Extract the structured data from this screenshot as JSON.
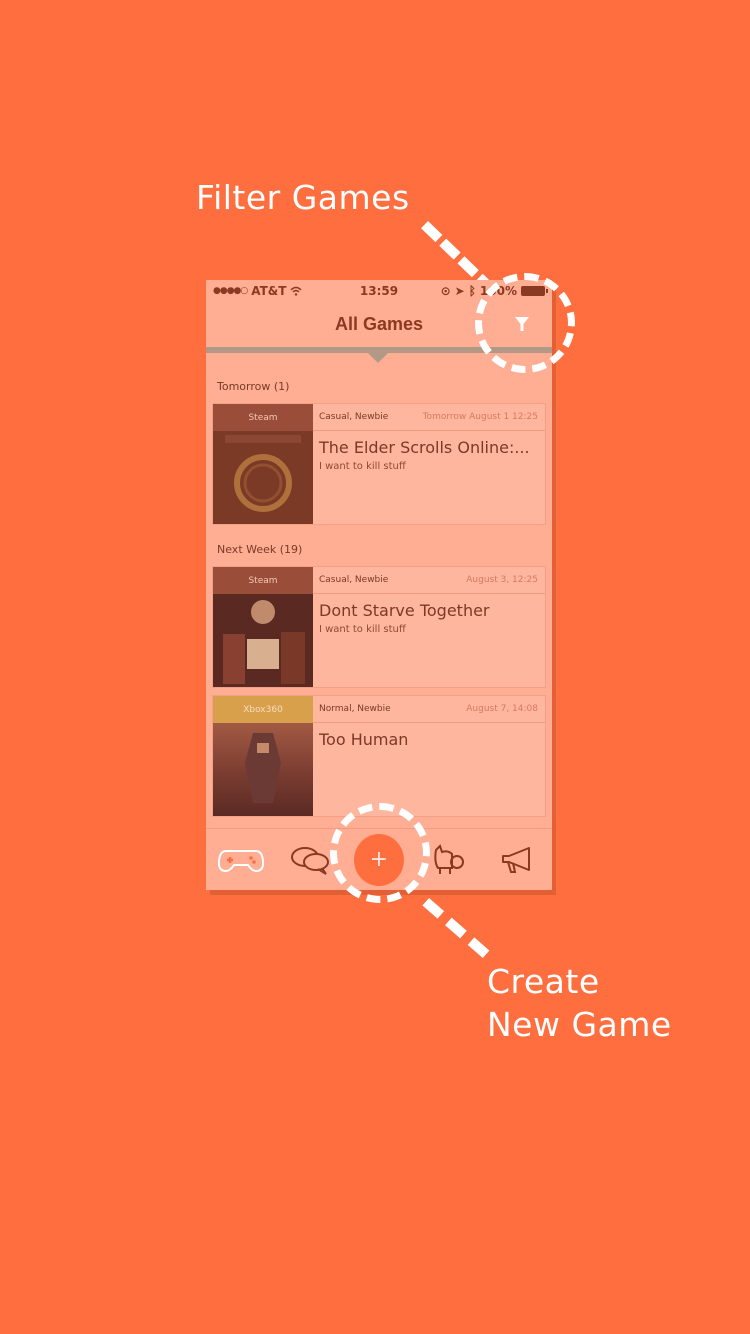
{
  "overlay": {
    "filter_caption": "Filter Games",
    "create_caption_line1": "Create",
    "create_caption_line2": "New Game"
  },
  "status_bar": {
    "carrier": "AT&T",
    "time": "13:59",
    "battery": "100%"
  },
  "nav": {
    "title": "All Games"
  },
  "sections": [
    {
      "header": "Tomorrow (1)",
      "games": [
        {
          "platform": "Steam",
          "tags": "Casual, Newbie",
          "date": "Tomorrow August 1 12:25",
          "title": "The Elder Scrolls Online:...",
          "description": "I want to kill stuff"
        }
      ]
    },
    {
      "header": "Next Week (19)",
      "games": [
        {
          "platform": "Steam",
          "tags": "Casual, Newbie",
          "date": "August 3, 12:25",
          "title": "Dont Starve Together",
          "description": "I want to kill stuff"
        },
        {
          "platform": "Xbox360",
          "tags": "Normal, Newbie",
          "date": "August 7, 14:08",
          "title": "Too Human",
          "description": ""
        }
      ]
    }
  ],
  "tab_bar": {
    "add_label": "+",
    "icons": [
      "gamepad-icon",
      "chat-bubbles-icon",
      "add-icon",
      "pets-icon",
      "megaphone-icon"
    ]
  },
  "colors": {
    "background": "#ff6e3f",
    "phone_overlay": "#ffad93",
    "accent": "#ff6e3f",
    "text_dark": "#7a3a24"
  }
}
